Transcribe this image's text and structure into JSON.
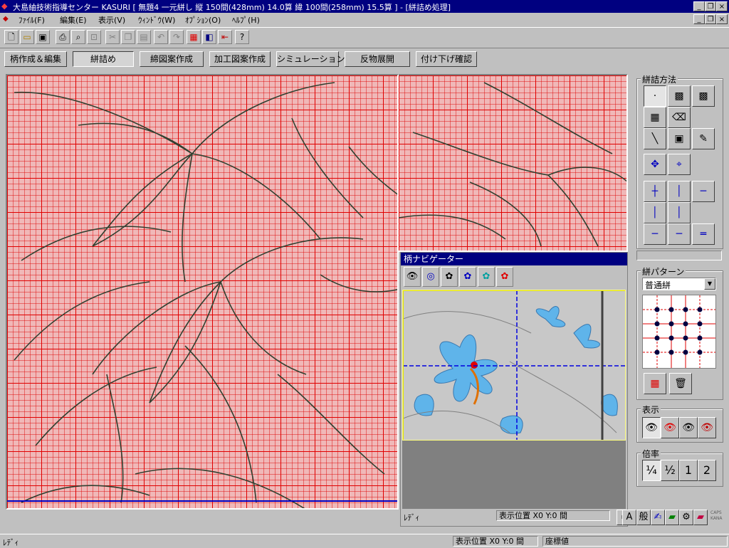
{
  "window": {
    "title": "大島紬技術指導センター KASURI [ 無題4 一元絣し 縦 150間(428mm) 14.0算 緯 100間(258mm) 15.5算 ] - [絣詰め処理]",
    "minimize": "_",
    "restore": "❐",
    "close": "×"
  },
  "menu": [
    "ﾌｧｲﾙ(F)",
    "編集(E)",
    "表示(V)",
    "ｳｨﾝﾄﾞｳ(W)",
    "ｵﾌﾟｼｮﾝ(O)",
    "ﾍﾙﾌﾟ(H)"
  ],
  "mode_tabs": [
    "柄作成＆編集",
    "絣詰め",
    "締図案作成",
    "加工図案作成",
    "シミュレーション",
    "反物展開",
    "付け下げ確認"
  ],
  "navigator": {
    "title": "柄ナビゲーター",
    "status": "ﾚﾃﾞｨ",
    "position": "表示位置 X0 Y:0 間"
  },
  "panel": {
    "method_label": "絣詰方法",
    "pattern_label": "絣パターン",
    "pattern_value": "普通絣",
    "display_label": "表示",
    "zoom_label": "倍率",
    "zoom_options": [
      "¼",
      "½",
      "1",
      "2"
    ]
  },
  "ime": {
    "a": "A",
    "mode": "般",
    "caps": "CAPS",
    "kana": "KANA"
  },
  "statusbar": {
    "ready": "ﾚﾃﾞｨ",
    "position": "表示位置 X0 Y:0 間",
    "coord": "座標値"
  },
  "colors": {
    "title_bg": "#000080",
    "grid_line": "#e00000",
    "cross_line": "#0000c0",
    "flower_blue": "#4aa8e8"
  }
}
